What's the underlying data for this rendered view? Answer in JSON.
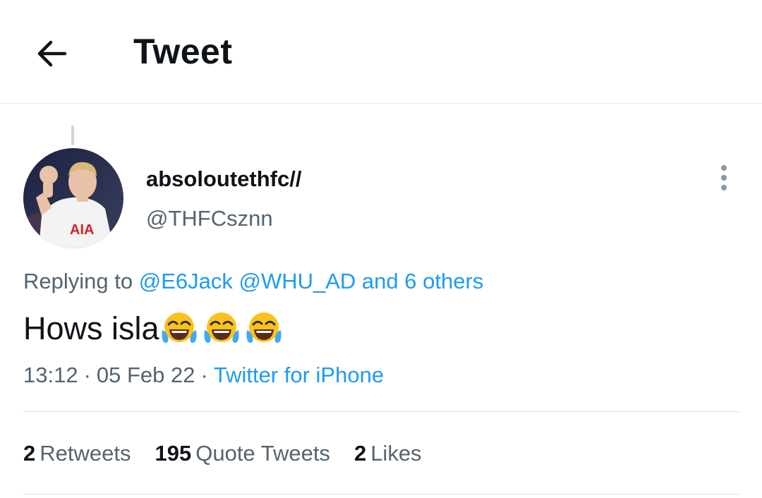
{
  "header": {
    "back_icon": "arrow-left-icon",
    "title": "Tweet"
  },
  "tweet": {
    "author": {
      "display_name": "absoloutethfc//",
      "handle": "@THFCsznn",
      "avatar_shirt_text": "AIA"
    },
    "more_icon": "vertical-dots-icon",
    "replying": {
      "prefix": "Replying to",
      "mention_1": "@E6Jack",
      "mention_2": "@WHU_AD",
      "others": "and 6 others"
    },
    "text": "Hows isla",
    "emojis": [
      "face-with-tears-of-joy",
      "face-with-tears-of-joy",
      "face-with-tears-of-joy"
    ],
    "time": "13:12",
    "date": "05 Feb 22",
    "separator": "·",
    "source": "Twitter for iPhone"
  },
  "stats": {
    "retweets_count": "2",
    "retweets_label": "Retweets",
    "quotes_count": "195",
    "quotes_label": "Quote Tweets",
    "likes_count": "2",
    "likes_label": "Likes"
  },
  "colors": {
    "link": "#1d9bf0",
    "secondary_text": "#536471",
    "primary_text": "#0f1419"
  }
}
